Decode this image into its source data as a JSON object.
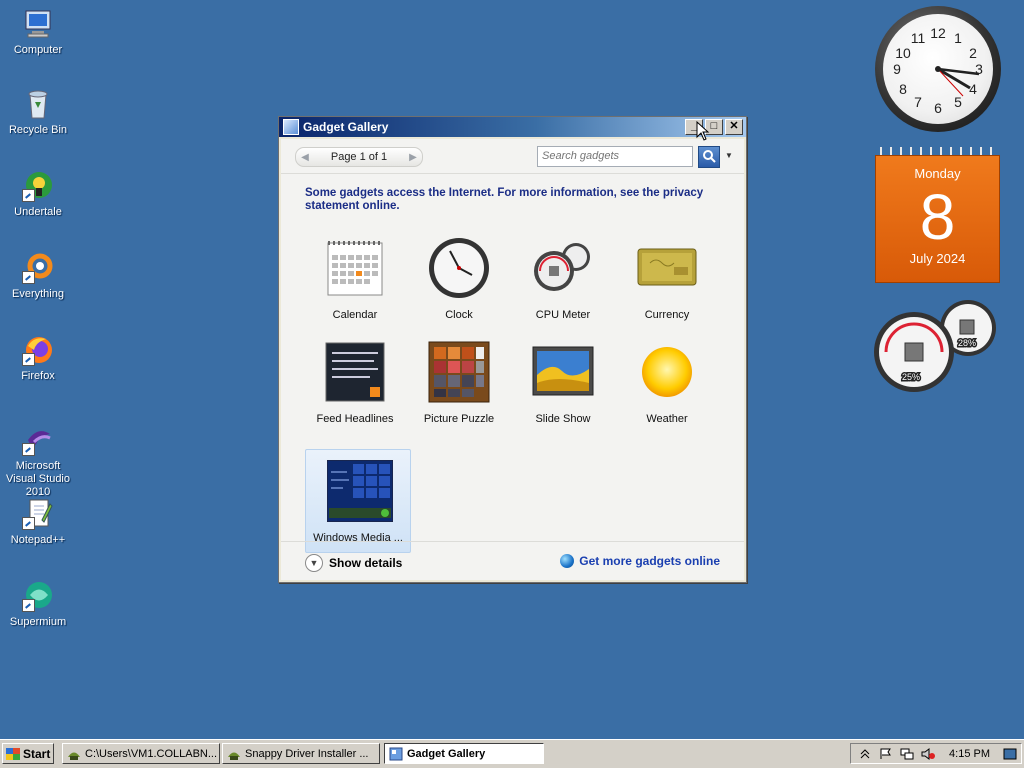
{
  "desktop": {
    "icons": [
      {
        "label": "Computer",
        "icon": "computer-icon"
      },
      {
        "label": "Recycle Bin",
        "icon": "recycle-bin-icon"
      },
      {
        "label": "Undertale",
        "icon": "undertale-icon"
      },
      {
        "label": "Everything",
        "icon": "everything-icon"
      },
      {
        "label": "Firefox",
        "icon": "firefox-icon"
      },
      {
        "label": "Microsoft Visual Studio 2010",
        "icon": "visual-studio-icon"
      },
      {
        "label": "Notepad++",
        "icon": "notepad-plus-plus-icon"
      },
      {
        "label": "Supermium",
        "icon": "supermium-icon"
      }
    ]
  },
  "gadgets": {
    "clock": {
      "numbers": [
        "12",
        "1",
        "2",
        "3",
        "4",
        "5",
        "6",
        "7",
        "8",
        "9",
        "10",
        "11"
      ]
    },
    "calendar": {
      "weekday": "Monday",
      "day": "8",
      "month_year": "July 2024"
    },
    "cpu_meter": {
      "cpu": "25%",
      "memory": "28%"
    }
  },
  "window": {
    "title": "Gadget Gallery",
    "controls": {
      "minimize": "_",
      "maximize": "□",
      "close": "✕"
    },
    "pager": {
      "prev": "◀",
      "text": "Page 1 of 1",
      "next": "▶"
    },
    "search": {
      "placeholder": "Search gadgets",
      "dropdown": "▼"
    },
    "notice": "Some gadgets access the Internet.  For more information, see the privacy statement online.",
    "gadgets": [
      {
        "name": "Calendar",
        "icon": "calendar-gadget-icon"
      },
      {
        "name": "Clock",
        "icon": "clock-gadget-icon"
      },
      {
        "name": "CPU Meter",
        "icon": "cpu-meter-gadget-icon"
      },
      {
        "name": "Currency",
        "icon": "currency-gadget-icon"
      },
      {
        "name": "Feed Headlines",
        "icon": "feed-headlines-gadget-icon"
      },
      {
        "name": "Picture Puzzle",
        "icon": "picture-puzzle-gadget-icon"
      },
      {
        "name": "Slide Show",
        "icon": "slide-show-gadget-icon"
      },
      {
        "name": "Weather",
        "icon": "weather-gadget-icon"
      },
      {
        "name": "Windows Media ...",
        "icon": "windows-media-center-gadget-icon",
        "selected": true
      }
    ],
    "footer": {
      "show_details": "Show details",
      "get_more": "Get more gadgets online"
    }
  },
  "taskbar": {
    "start": "Start",
    "tasks": [
      {
        "label": "C:\\Users\\VM1.COLLABN...",
        "active": false
      },
      {
        "label": "Snappy Driver Installer ...",
        "active": false
      },
      {
        "label": "Gadget Gallery",
        "active": true
      }
    ],
    "tray": {
      "time": "4:15 PM",
      "icons": [
        "show-hidden-icon",
        "action-center-flag-icon",
        "network-icon",
        "volume-muted-icon",
        "show-desktop-icon"
      ]
    }
  },
  "colors": {
    "desktop": "#3a6ea5",
    "calendar": "#e8680f",
    "link": "#1a3fb0",
    "notice": "#1b2d86"
  }
}
